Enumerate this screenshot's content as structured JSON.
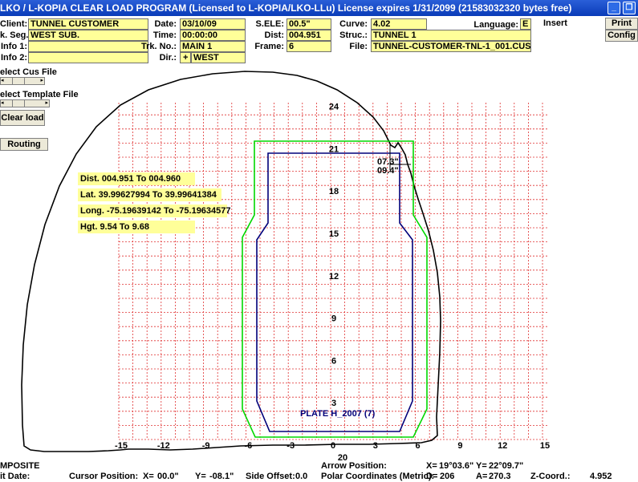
{
  "window": {
    "title": "LKO / L-KOPIA CLEAR LOAD PROGRAM   (Licensed to L-KOPIA/LKO-LLu)     License expires 1/31/2099     (21583032320 bytes free)"
  },
  "header": {
    "client_label": "Client:",
    "client_value": "TUNNEL CUSTOMER",
    "seg_label": "k. Seg.:",
    "seg_value": "WEST SUB.",
    "info1_label": "Info 1:",
    "info1_value": "",
    "info2_label": "Info 2:",
    "info2_value": "",
    "date_label": "Date:",
    "date_value": "03/10/09",
    "time_label": "Time:",
    "time_value": "00:00:00",
    "trk_label": "Trk. No.:",
    "trk_value": "MAIN 1",
    "dir_label": "Dir.:",
    "dir_sign": "+",
    "dir_value": "WEST",
    "sele_label": "S.ELE:",
    "sele_value": "00.5\"",
    "dist_label": "Dist:",
    "dist_value": "004.951",
    "frame_label": "Frame:",
    "frame_value": "6",
    "curve_label": "Curve:",
    "curve_value": "4.02",
    "language_label": "Language:",
    "language_value": "E",
    "insert_label": "Insert",
    "struc_label": "Struc.:",
    "struc_value": "TUNNEL 1",
    "file_label": "File:",
    "file_value": "TUNNEL-CUSTOMER-TNL-1_001.CUS"
  },
  "toolbar": {
    "print_label": "Print",
    "config_label": "Config",
    "cus_file_label": "elect Cus File",
    "template_file_label": "elect Template File",
    "clear_load_label": "Clear load",
    "routing_label": "Routing"
  },
  "info_boxes": {
    "dist": "Dist. 004.951 To 004.960",
    "lat": "Lat. 39.99627994 To 39.99641384",
    "long": "Long. -75.19639142 To -75.19634577",
    "hgt": "Hgt. 9.54 To 9.68"
  },
  "chart_data": {
    "type": "clearance-diagram",
    "y_ticks": [
      3,
      6,
      9,
      12,
      15,
      18,
      21,
      24
    ],
    "x_ticks": [
      -15,
      -12,
      -9,
      -6,
      -3,
      0,
      3,
      6,
      9,
      12,
      15
    ],
    "x_tick_labels": [
      "-15",
      "-12",
      "-9",
      "-6",
      "-3",
      "0",
      "3",
      "6",
      "9",
      "12",
      "15"
    ],
    "x_extra_label": "20",
    "annotations": {
      "dim_top": "07.3\"",
      "dim_side": "09.4\"",
      "plate": "PLATE H_2007  (7)"
    },
    "outline_color": "#000000",
    "clearance_color": "#00d800",
    "plate_color": "#00007a",
    "grid_color": "#e03030"
  },
  "status": {
    "mode": "MPOSITE",
    "edit_date_label": "it Date:",
    "cursor_label": "Cursor Position:",
    "x_label": "X=",
    "x_value": "00.0\"",
    "y_label": "Y=",
    "y_value": "-08.1\"",
    "side_offset_label": "Side Offset:",
    "side_offset_value": "0.0",
    "arrow_label": "Arrow Position:",
    "arrow_x_label": "X=",
    "arrow_x_value": "19°03.6\"",
    "arrow_y_label": "Y=",
    "arrow_y_value": "22°09.7\"",
    "polar_label": "Polar Coordinates (Metric):",
    "d_label": "D=",
    "d_value": "206",
    "a_label": "A=",
    "a_value": "270.3",
    "z_label": "Z-Coord.:",
    "z_value": "4.952"
  }
}
